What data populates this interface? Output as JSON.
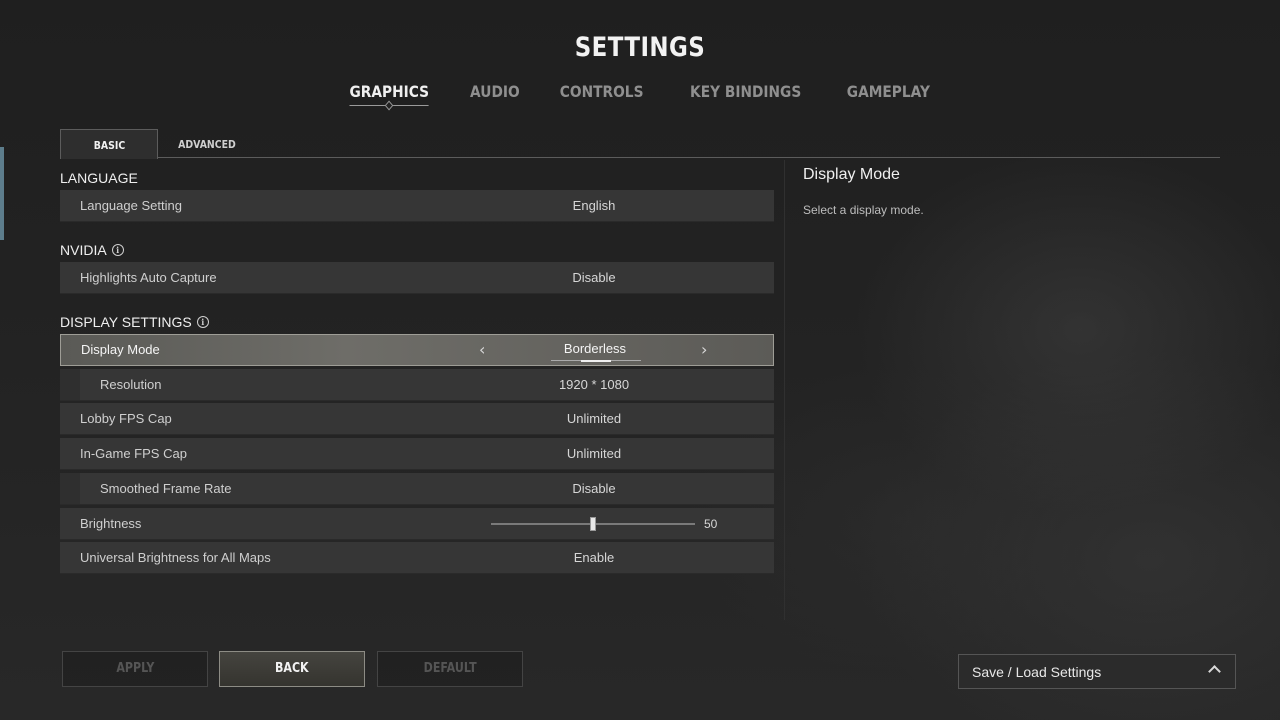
{
  "header": {
    "title": "SETTINGS"
  },
  "top_tabs": [
    {
      "label": "GRAPHICS",
      "active": true
    },
    {
      "label": "AUDIO",
      "active": false
    },
    {
      "label": "CONTROLS",
      "active": false
    },
    {
      "label": "KEY BINDINGS",
      "active": false
    },
    {
      "label": "GAMEPLAY",
      "active": false
    }
  ],
  "sub_tabs": [
    {
      "label": "BASIC",
      "active": true
    },
    {
      "label": "ADVANCED",
      "active": false
    }
  ],
  "sections": {
    "language": {
      "title": "LANGUAGE",
      "rows": [
        {
          "label": "Language Setting",
          "value": "English"
        }
      ]
    },
    "nvidia": {
      "title": "NVIDIA",
      "info_icon": "info-icon",
      "rows": [
        {
          "label": "Highlights Auto Capture",
          "value": "Disable"
        }
      ]
    },
    "display": {
      "title": "DISPLAY SETTINGS",
      "info_icon": "info-icon",
      "rows": [
        {
          "label": "Display Mode",
          "value": "Borderless",
          "selected": true,
          "left_icon": "chevron-left-icon",
          "right_icon": "chevron-right-icon"
        },
        {
          "label": "Resolution",
          "value": "1920 * 1080",
          "indented": true
        },
        {
          "label": "Lobby FPS Cap",
          "value": "Unlimited"
        },
        {
          "label": "In-Game FPS Cap",
          "value": "Unlimited"
        },
        {
          "label": "Smoothed Frame Rate",
          "value": "Disable",
          "indented": true
        },
        {
          "label": "Brightness",
          "value": "50",
          "slider_fraction": 0.5
        },
        {
          "label": "Universal Brightness for All Maps",
          "value": "Enable"
        }
      ]
    }
  },
  "description": {
    "title": "Display Mode",
    "text": "Select a display mode."
  },
  "footer": {
    "apply": "APPLY",
    "back": "BACK",
    "default": "DEFAULT",
    "save_load": "Save / Load Settings",
    "save_load_icon": "chevron-up-icon"
  },
  "colors": {
    "accent": "#5d7d8c",
    "selected_row": "#6e6d68"
  }
}
